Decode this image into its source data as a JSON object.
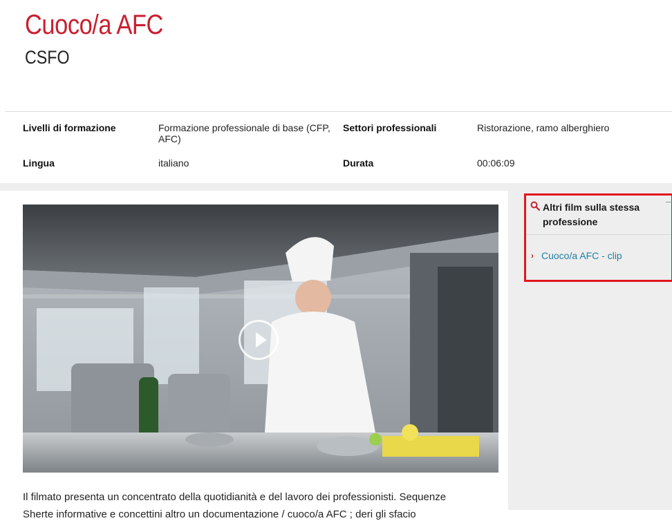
{
  "header": {
    "title": "Cuoco/a AFC",
    "subtitle": "CSFO"
  },
  "info": {
    "levels_label": "Livelli di formazione",
    "levels_value_line1": "Formazione professionale di base (CFP,",
    "levels_value_line2": "AFC)",
    "sectors_label": "Settori professionali",
    "sectors_value": "Ristorazione, ramo alberghiero",
    "language_label": "Lingua",
    "language_value": "italiano",
    "duration_label": "Durata",
    "duration_value": "00:06:09"
  },
  "sidebar": {
    "related_title": "Altri film sulla stessa professione",
    "items": [
      {
        "label": "Cuoco/a AFC - clip"
      }
    ]
  },
  "main": {
    "description_line1": "Il filmato presenta un concentrato della quotidianità e del lavoro dei professionisti. Sequenze",
    "description_line2": "Sherte informative e concettini altro un documentazione / cuoco/a AFC ; deri gli sfacio"
  },
  "video": {
    "play_icon": "play-icon"
  },
  "colors": {
    "title": "#c8202f",
    "link": "#1f7fa6",
    "highlight_border": "#e3151c",
    "band": "#eeeeee"
  }
}
